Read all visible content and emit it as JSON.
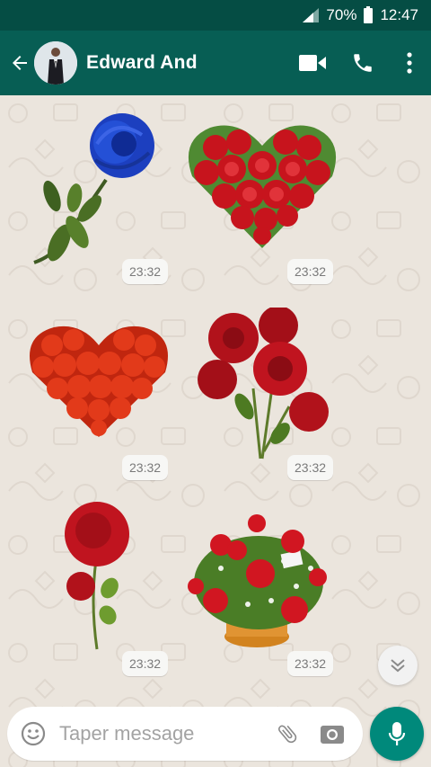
{
  "status_bar": {
    "battery": "70%",
    "time": "12:47"
  },
  "header": {
    "contact_name": "Edward And",
    "back_icon": "arrow-left-icon",
    "video_icon": "video-camera-icon",
    "call_icon": "phone-icon",
    "menu_icon": "more-vertical-icon"
  },
  "messages": [
    {
      "sticker": "blue-rose",
      "time": "23:32"
    },
    {
      "sticker": "rose-heart",
      "time": "23:32"
    },
    {
      "sticker": "orange-rose-heart",
      "time": "23:32"
    },
    {
      "sticker": "red-rose-bouquet",
      "time": "23:32"
    },
    {
      "sticker": "single-red-rose",
      "time": "23:32"
    },
    {
      "sticker": "rose-basket",
      "time": "23:32"
    }
  ],
  "composer": {
    "placeholder": "Taper message"
  },
  "colors": {
    "header": "#075e54",
    "status": "#054d44",
    "accent": "#00897b"
  }
}
